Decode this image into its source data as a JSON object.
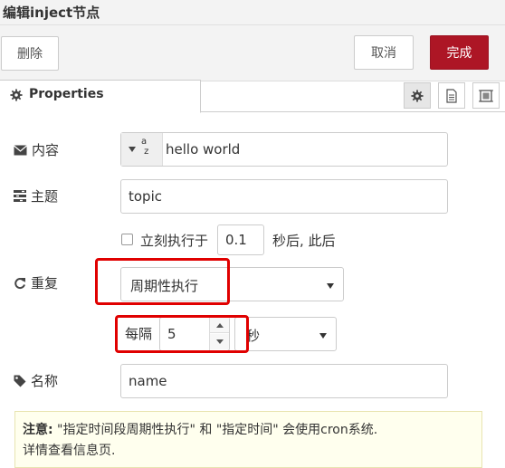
{
  "window": {
    "title": "编辑inject节点"
  },
  "toolbar": {
    "delete_label": "删除",
    "cancel_label": "取消",
    "done_label": "完成"
  },
  "tabs": {
    "properties_label": "Properties"
  },
  "form": {
    "content": {
      "label": "内容",
      "type_icon": "az-string-icon",
      "type_text": "a z",
      "value": "hello world"
    },
    "topic": {
      "label": "主题",
      "value": "topic"
    },
    "immediate": {
      "label": "立刻执行于",
      "delay": "0.1",
      "suffix": "秒后, 此后",
      "checked": false
    },
    "repeat": {
      "label": "重复",
      "selected": "周期性执行"
    },
    "interval": {
      "prefix": "每隔",
      "value": "5",
      "unit": "秒"
    },
    "name": {
      "label": "名称",
      "value": "name"
    }
  },
  "note": {
    "strong": "注意:",
    "line1": " \"指定时间段周期性执行\" 和 \"指定时间\" 会使用cron系统.",
    "line2": "详情查看信息页."
  },
  "colors": {
    "done_button": "#ad1625",
    "highlight": "#e00000",
    "note_bg": "#ffffee"
  }
}
